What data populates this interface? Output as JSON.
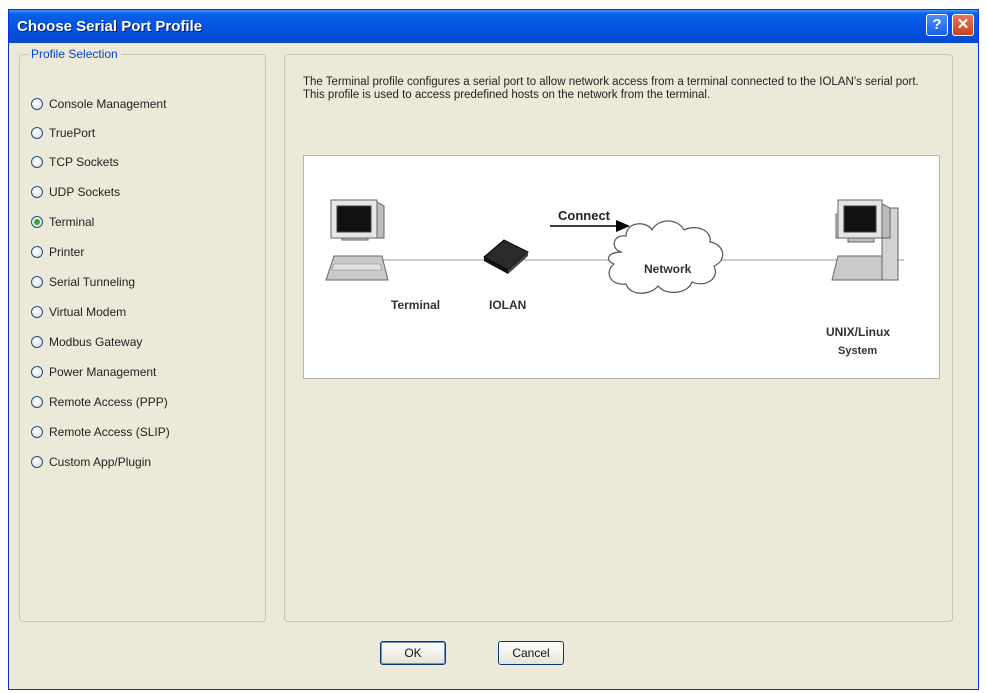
{
  "window": {
    "title": "Choose Serial Port Profile",
    "help_glyph": "?",
    "close_glyph": "✕"
  },
  "profile_selection": {
    "legend": "Profile Selection",
    "selected": "Terminal",
    "options": [
      "Console Management",
      "TruePort",
      "TCP Sockets",
      "UDP Sockets",
      "Terminal",
      "Printer",
      "Serial Tunneling",
      "Virtual Modem",
      "Modbus Gateway",
      "Power Management",
      "Remote Access (PPP)",
      "Remote Access (SLIP)",
      "Custom App/Plugin"
    ]
  },
  "description": "The Terminal profile configures a serial port to allow network access from a terminal connected to the IOLAN’s serial port. This profile is used to access predefined hosts on the network from the terminal.",
  "diagram": {
    "connect_label": "Connect",
    "network_label": "Network",
    "terminal_label": "Terminal",
    "iolan_label": "IOLAN",
    "unix_label": "UNIX/Linux",
    "system_label": "System"
  },
  "buttons": {
    "ok": "OK",
    "cancel": "Cancel"
  },
  "icons": {
    "help": "help-icon",
    "close": "close-icon",
    "terminal": "terminal-computer-icon",
    "iolan": "iolan-device-icon",
    "network": "network-cloud-icon",
    "server": "unix-system-icon"
  },
  "colors": {
    "titlebar": "#0553e0",
    "window_bg": "#ece9d8",
    "legend_text": "#0046d5",
    "radio_checked": "#3aa43a"
  }
}
